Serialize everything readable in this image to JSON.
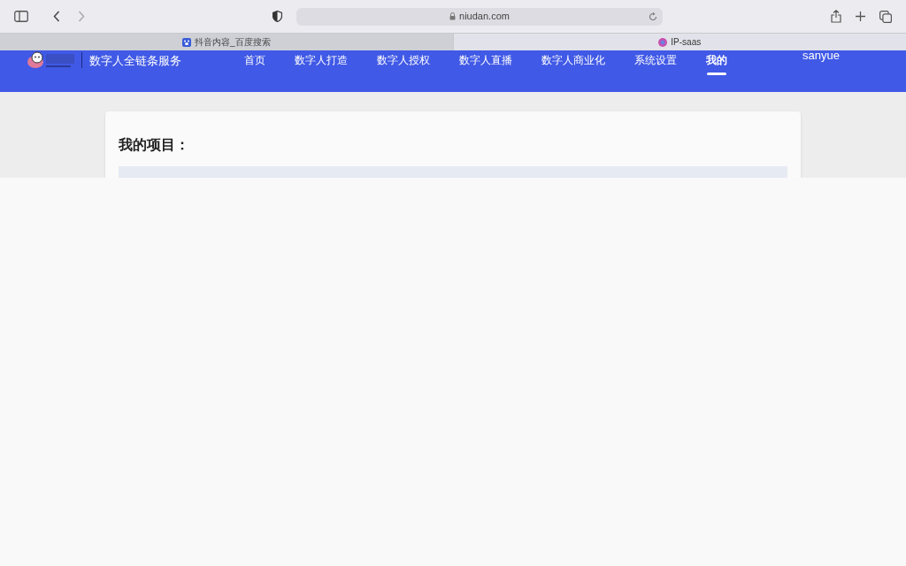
{
  "browser": {
    "address": "niudan.com",
    "tabs": [
      {
        "title": "抖音内容_百度搜索",
        "selected": false
      },
      {
        "title": "IP-saas",
        "selected": true
      }
    ]
  },
  "site": {
    "tagline": "数字人全链条服务",
    "nav": [
      {
        "label": "首页",
        "selected": false
      },
      {
        "label": "数字人打造",
        "selected": false
      },
      {
        "label": "数字人授权",
        "selected": false
      },
      {
        "label": "数字人直播",
        "selected": false
      },
      {
        "label": "数字人商业化",
        "selected": false
      },
      {
        "label": "系统设置",
        "selected": false
      },
      {
        "label": "我的",
        "selected": true
      }
    ],
    "user": "sanyue"
  },
  "card": {
    "title": "我的项目："
  }
}
